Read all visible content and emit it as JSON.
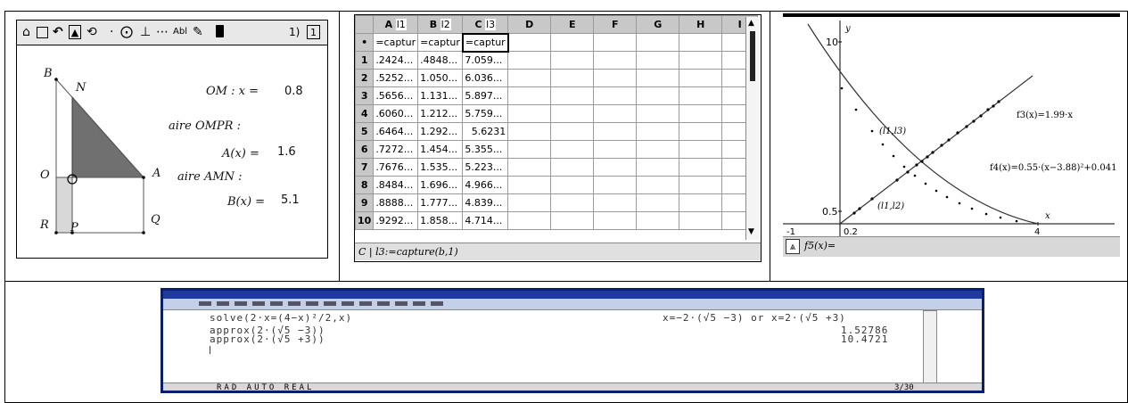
{
  "geometry": {
    "toolbar": {
      "page_label": "1)",
      "page_number": "1"
    },
    "points": {
      "B": "B",
      "N": "N",
      "O": "O",
      "A": "A",
      "R": "R",
      "P": "P",
      "Q": "Q"
    },
    "measure_om_label": "OM : x =",
    "measure_om_value": "0.8",
    "aire_ompr_label": "aire OMPR :",
    "a_label": "A(x) =",
    "a_value": "1.6",
    "aire_amn_label": "aire AMN :",
    "b_label": "B(x) =",
    "b_value": "5.1"
  },
  "spreadsheet": {
    "columns": [
      {
        "letter": "A",
        "name": "l1"
      },
      {
        "letter": "B",
        "name": "l2"
      },
      {
        "letter": "C",
        "name": "l3"
      },
      {
        "letter": "D",
        "name": ""
      },
      {
        "letter": "E",
        "name": ""
      },
      {
        "letter": "F",
        "name": ""
      },
      {
        "letter": "G",
        "name": ""
      },
      {
        "letter": "H",
        "name": ""
      },
      {
        "letter": "I",
        "name": ""
      }
    ],
    "formula_row": {
      "marker": "•",
      "a": "=captur",
      "b": "=captur",
      "c": "=captur"
    },
    "rows": [
      {
        "n": "1",
        "a": ".2424...",
        "b": ".4848...",
        "c": "7.059..."
      },
      {
        "n": "2",
        "a": ".5252...",
        "b": "1.050...",
        "c": "6.036..."
      },
      {
        "n": "3",
        "a": ".5656...",
        "b": "1.131...",
        "c": "5.897..."
      },
      {
        "n": "4",
        "a": ".6060...",
        "b": "1.212...",
        "c": "5.759..."
      },
      {
        "n": "5",
        "a": ".6464...",
        "b": "1.292...",
        "c": "5.6231"
      },
      {
        "n": "6",
        "a": ".7272...",
        "b": "1.454...",
        "c": "5.355..."
      },
      {
        "n": "7",
        "a": ".7676...",
        "b": "1.535...",
        "c": "5.223..."
      },
      {
        "n": "8",
        "a": ".8484...",
        "b": "1.696...",
        "c": "4.966..."
      },
      {
        "n": "9",
        "a": ".8888...",
        "b": "1.777...",
        "c": "4.839..."
      },
      {
        "n": "10",
        "a": ".9292...",
        "b": "1.858...",
        "c": "4.714..."
      }
    ],
    "status_cell": "C",
    "status_formula": "l3:=capture(b,1)"
  },
  "graph": {
    "y_max_label": "10",
    "y_axis_label": "y",
    "x_axis_label": "x",
    "y_tick_label": "0.5",
    "x_min_label": "-1",
    "x_tick_label": "0.2",
    "x_max_label": "4",
    "f3_label": "f3(x)=1.99·x",
    "f4_label": "f4(x)=0.55·(x−3.88)²+0.041",
    "l1l3_label": "(l1,l3)",
    "l1l2_label": "(l1,l2)",
    "entry_label": "f5(x)="
  },
  "calculator": {
    "line1_left": "solve(2·x=(4−x)²/2,x)",
    "line1_right": "x=−2·(√5 −3) or x=2·(√5 +3)",
    "line2_left": "approx(2·(√5 −3))",
    "line2_right": "1.52786",
    "line3_left": "approx(2·(√5 +3))",
    "line3_right": "10.4721",
    "status": "RAD AUTO REAL",
    "status_right": "3/30"
  }
}
